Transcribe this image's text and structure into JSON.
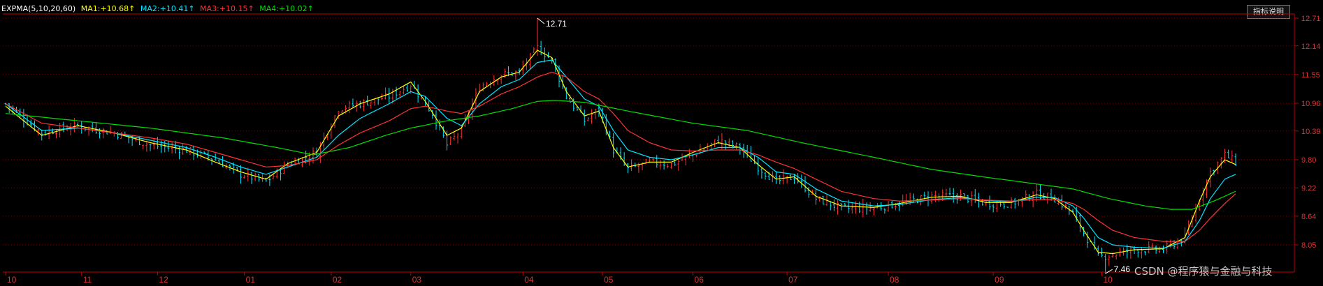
{
  "legend": {
    "name": "EXPMA(5,10,20,60)",
    "items": [
      {
        "label": "MA1:",
        "value": "+10.68↑",
        "color": "#ffff00"
      },
      {
        "label": "MA2:",
        "value": "+10.41↑",
        "color": "#00e5ff"
      },
      {
        "label": "MA3:",
        "value": "+10.15↑",
        "color": "#ff3333"
      },
      {
        "label": "MA4:",
        "value": "+10.02↑",
        "color": "#00dd00"
      }
    ]
  },
  "help_button": "指标说明",
  "watermark": "CSDN @程序猿与金融与科技",
  "colors": {
    "up": "#ff3333",
    "down": "#00e5ff",
    "grid": "#8b0000",
    "axis": "#c00000",
    "tick_text": "#dd3333"
  },
  "chart_data": {
    "type": "candlestick",
    "title": "",
    "xlabel": "",
    "ylabel": "",
    "y_ticks": [
      "12.71",
      "12.14",
      "11.55",
      "10.96",
      "10.39",
      "9.80",
      "9.22",
      "8.64",
      "8.05"
    ],
    "ylim": [
      7.6,
      12.85
    ],
    "x_ticks": [
      {
        "label": "10",
        "index": 0
      },
      {
        "label": "11",
        "index": 21
      },
      {
        "label": "12",
        "index": 42
      },
      {
        "label": "01",
        "index": 66
      },
      {
        "label": "02",
        "index": 90
      },
      {
        "label": "03",
        "index": 112
      },
      {
        "label": "04",
        "index": 143
      },
      {
        "label": "05",
        "index": 165
      },
      {
        "label": "06",
        "index": 190
      },
      {
        "label": "07",
        "index": 216
      },
      {
        "label": "08",
        "index": 244
      },
      {
        "label": "09",
        "index": 273
      },
      {
        "label": "10",
        "index": 303
      }
    ],
    "annotations": [
      {
        "text": "12.71",
        "index": 147,
        "price": 12.71
      },
      {
        "text": "7.46",
        "index": 304,
        "price": 7.46
      }
    ],
    "close_anchors": [
      [
        0,
        10.95
      ],
      [
        10,
        10.35
      ],
      [
        20,
        10.5
      ],
      [
        30,
        10.35
      ],
      [
        40,
        10.1
      ],
      [
        50,
        10.0
      ],
      [
        58,
        9.8
      ],
      [
        65,
        9.5
      ],
      [
        72,
        9.35
      ],
      [
        78,
        9.7
      ],
      [
        86,
        9.95
      ],
      [
        92,
        10.85
      ],
      [
        98,
        10.95
      ],
      [
        106,
        11.1
      ],
      [
        112,
        11.35
      ],
      [
        118,
        10.75
      ],
      [
        122,
        10.1
      ],
      [
        126,
        10.4
      ],
      [
        131,
        11.3
      ],
      [
        137,
        11.55
      ],
      [
        142,
        11.6
      ],
      [
        147,
        12.1
      ],
      [
        151,
        11.85
      ],
      [
        155,
        11.1
      ],
      [
        160,
        10.6
      ],
      [
        164,
        10.85
      ],
      [
        168,
        10.0
      ],
      [
        172,
        9.6
      ],
      [
        178,
        9.75
      ],
      [
        184,
        9.7
      ],
      [
        190,
        9.9
      ],
      [
        197,
        10.2
      ],
      [
        203,
        10.05
      ],
      [
        208,
        9.65
      ],
      [
        213,
        9.35
      ],
      [
        218,
        9.45
      ],
      [
        224,
        9.0
      ],
      [
        231,
        8.8
      ],
      [
        240,
        8.8
      ],
      [
        247,
        8.9
      ],
      [
        256,
        9.05
      ],
      [
        264,
        9.05
      ],
      [
        271,
        8.9
      ],
      [
        278,
        8.9
      ],
      [
        285,
        9.1
      ],
      [
        290,
        9.0
      ],
      [
        295,
        8.7
      ],
      [
        298,
        8.3
      ],
      [
        302,
        7.8
      ],
      [
        306,
        7.85
      ],
      [
        312,
        7.95
      ],
      [
        320,
        7.95
      ],
      [
        326,
        8.2
      ],
      [
        330,
        9.0
      ],
      [
        333,
        9.55
      ],
      [
        337,
        9.9
      ],
      [
        340,
        9.75
      ]
    ],
    "ma_anchors": {
      "MA1": [
        [
          0,
          10.9
        ],
        [
          10,
          10.3
        ],
        [
          20,
          10.5
        ],
        [
          30,
          10.35
        ],
        [
          40,
          10.15
        ],
        [
          50,
          10.0
        ],
        [
          58,
          9.75
        ],
        [
          65,
          9.55
        ],
        [
          72,
          9.4
        ],
        [
          78,
          9.72
        ],
        [
          86,
          9.95
        ],
        [
          92,
          10.7
        ],
        [
          98,
          10.95
        ],
        [
          106,
          11.15
        ],
        [
          112,
          11.4
        ],
        [
          116,
          11.0
        ],
        [
          122,
          10.3
        ],
        [
          126,
          10.45
        ],
        [
          131,
          11.2
        ],
        [
          137,
          11.5
        ],
        [
          142,
          11.6
        ],
        [
          147,
          12.05
        ],
        [
          151,
          11.9
        ],
        [
          155,
          11.2
        ],
        [
          160,
          10.7
        ],
        [
          164,
          10.8
        ],
        [
          168,
          10.05
        ],
        [
          172,
          9.65
        ],
        [
          178,
          9.75
        ],
        [
          184,
          9.75
        ],
        [
          190,
          9.95
        ],
        [
          197,
          10.15
        ],
        [
          203,
          10.05
        ],
        [
          208,
          9.7
        ],
        [
          213,
          9.4
        ],
        [
          218,
          9.45
        ],
        [
          224,
          9.05
        ],
        [
          231,
          8.85
        ],
        [
          240,
          8.82
        ],
        [
          247,
          8.9
        ],
        [
          256,
          9.03
        ],
        [
          264,
          9.05
        ],
        [
          271,
          8.92
        ],
        [
          278,
          8.92
        ],
        [
          285,
          9.08
        ],
        [
          290,
          9.0
        ],
        [
          295,
          8.72
        ],
        [
          298,
          8.35
        ],
        [
          302,
          7.9
        ],
        [
          306,
          7.87
        ],
        [
          312,
          7.95
        ],
        [
          320,
          7.97
        ],
        [
          326,
          8.2
        ],
        [
          330,
          8.95
        ],
        [
          333,
          9.45
        ],
        [
          337,
          9.8
        ],
        [
          340,
          9.7
        ]
      ],
      "MA2": [
        [
          0,
          10.95
        ],
        [
          10,
          10.4
        ],
        [
          20,
          10.45
        ],
        [
          30,
          10.35
        ],
        [
          40,
          10.2
        ],
        [
          50,
          10.05
        ],
        [
          58,
          9.85
        ],
        [
          65,
          9.65
        ],
        [
          72,
          9.5
        ],
        [
          78,
          9.65
        ],
        [
          86,
          9.85
        ],
        [
          92,
          10.3
        ],
        [
          98,
          10.65
        ],
        [
          106,
          10.95
        ],
        [
          112,
          11.2
        ],
        [
          116,
          11.1
        ],
        [
          122,
          10.65
        ],
        [
          126,
          10.5
        ],
        [
          131,
          10.95
        ],
        [
          137,
          11.3
        ],
        [
          142,
          11.45
        ],
        [
          147,
          11.8
        ],
        [
          151,
          11.85
        ],
        [
          155,
          11.5
        ],
        [
          160,
          11.05
        ],
        [
          164,
          10.9
        ],
        [
          168,
          10.4
        ],
        [
          172,
          10.0
        ],
        [
          178,
          9.85
        ],
        [
          184,
          9.8
        ],
        [
          190,
          9.9
        ],
        [
          197,
          10.05
        ],
        [
          203,
          10.05
        ],
        [
          208,
          9.85
        ],
        [
          213,
          9.55
        ],
        [
          218,
          9.5
        ],
        [
          224,
          9.2
        ],
        [
          231,
          8.95
        ],
        [
          240,
          8.85
        ],
        [
          247,
          8.88
        ],
        [
          256,
          8.98
        ],
        [
          264,
          9.02
        ],
        [
          271,
          8.96
        ],
        [
          278,
          8.93
        ],
        [
          285,
          9.03
        ],
        [
          290,
          9.02
        ],
        [
          295,
          8.85
        ],
        [
          298,
          8.6
        ],
        [
          302,
          8.2
        ],
        [
          306,
          8.05
        ],
        [
          312,
          8.0
        ],
        [
          320,
          7.98
        ],
        [
          326,
          8.12
        ],
        [
          330,
          8.55
        ],
        [
          333,
          9.0
        ],
        [
          337,
          9.4
        ],
        [
          340,
          9.5
        ]
      ],
      "MA3": [
        [
          0,
          10.95
        ],
        [
          10,
          10.55
        ],
        [
          20,
          10.45
        ],
        [
          30,
          10.35
        ],
        [
          40,
          10.25
        ],
        [
          50,
          10.12
        ],
        [
          58,
          9.95
        ],
        [
          65,
          9.8
        ],
        [
          72,
          9.65
        ],
        [
          78,
          9.68
        ],
        [
          86,
          9.8
        ],
        [
          92,
          10.1
        ],
        [
          98,
          10.35
        ],
        [
          106,
          10.6
        ],
        [
          112,
          10.85
        ],
        [
          116,
          10.9
        ],
        [
          122,
          10.8
        ],
        [
          126,
          10.75
        ],
        [
          131,
          10.9
        ],
        [
          137,
          11.15
        ],
        [
          142,
          11.3
        ],
        [
          147,
          11.5
        ],
        [
          151,
          11.6
        ],
        [
          155,
          11.5
        ],
        [
          160,
          11.2
        ],
        [
          164,
          11.05
        ],
        [
          168,
          10.75
        ],
        [
          172,
          10.4
        ],
        [
          178,
          10.15
        ],
        [
          184,
          10.0
        ],
        [
          190,
          9.98
        ],
        [
          197,
          10.0
        ],
        [
          203,
          10.0
        ],
        [
          208,
          9.9
        ],
        [
          213,
          9.75
        ],
        [
          218,
          9.62
        ],
        [
          224,
          9.4
        ],
        [
          231,
          9.15
        ],
        [
          240,
          9.0
        ],
        [
          247,
          8.95
        ],
        [
          256,
          8.97
        ],
        [
          264,
          9.0
        ],
        [
          271,
          8.97
        ],
        [
          278,
          8.95
        ],
        [
          285,
          8.98
        ],
        [
          290,
          8.98
        ],
        [
          295,
          8.9
        ],
        [
          298,
          8.78
        ],
        [
          302,
          8.55
        ],
        [
          306,
          8.35
        ],
        [
          312,
          8.2
        ],
        [
          320,
          8.12
        ],
        [
          326,
          8.12
        ],
        [
          330,
          8.35
        ],
        [
          333,
          8.6
        ],
        [
          337,
          8.9
        ],
        [
          340,
          9.1
        ]
      ],
      "MA4": [
        [
          0,
          10.75
        ],
        [
          20,
          10.6
        ],
        [
          40,
          10.45
        ],
        [
          60,
          10.25
        ],
        [
          75,
          10.05
        ],
        [
          85,
          9.9
        ],
        [
          95,
          10.05
        ],
        [
          105,
          10.3
        ],
        [
          112,
          10.45
        ],
        [
          122,
          10.6
        ],
        [
          131,
          10.7
        ],
        [
          140,
          10.85
        ],
        [
          147,
          11.0
        ],
        [
          152,
          11.02
        ],
        [
          160,
          10.98
        ],
        [
          172,
          10.8
        ],
        [
          190,
          10.55
        ],
        [
          205,
          10.4
        ],
        [
          220,
          10.15
        ],
        [
          240,
          9.85
        ],
        [
          256,
          9.6
        ],
        [
          270,
          9.45
        ],
        [
          285,
          9.3
        ],
        [
          295,
          9.2
        ],
        [
          305,
          9.0
        ],
        [
          315,
          8.85
        ],
        [
          322,
          8.78
        ],
        [
          328,
          8.78
        ],
        [
          334,
          8.95
        ],
        [
          340,
          9.15
        ]
      ]
    },
    "n_bars": 341
  }
}
